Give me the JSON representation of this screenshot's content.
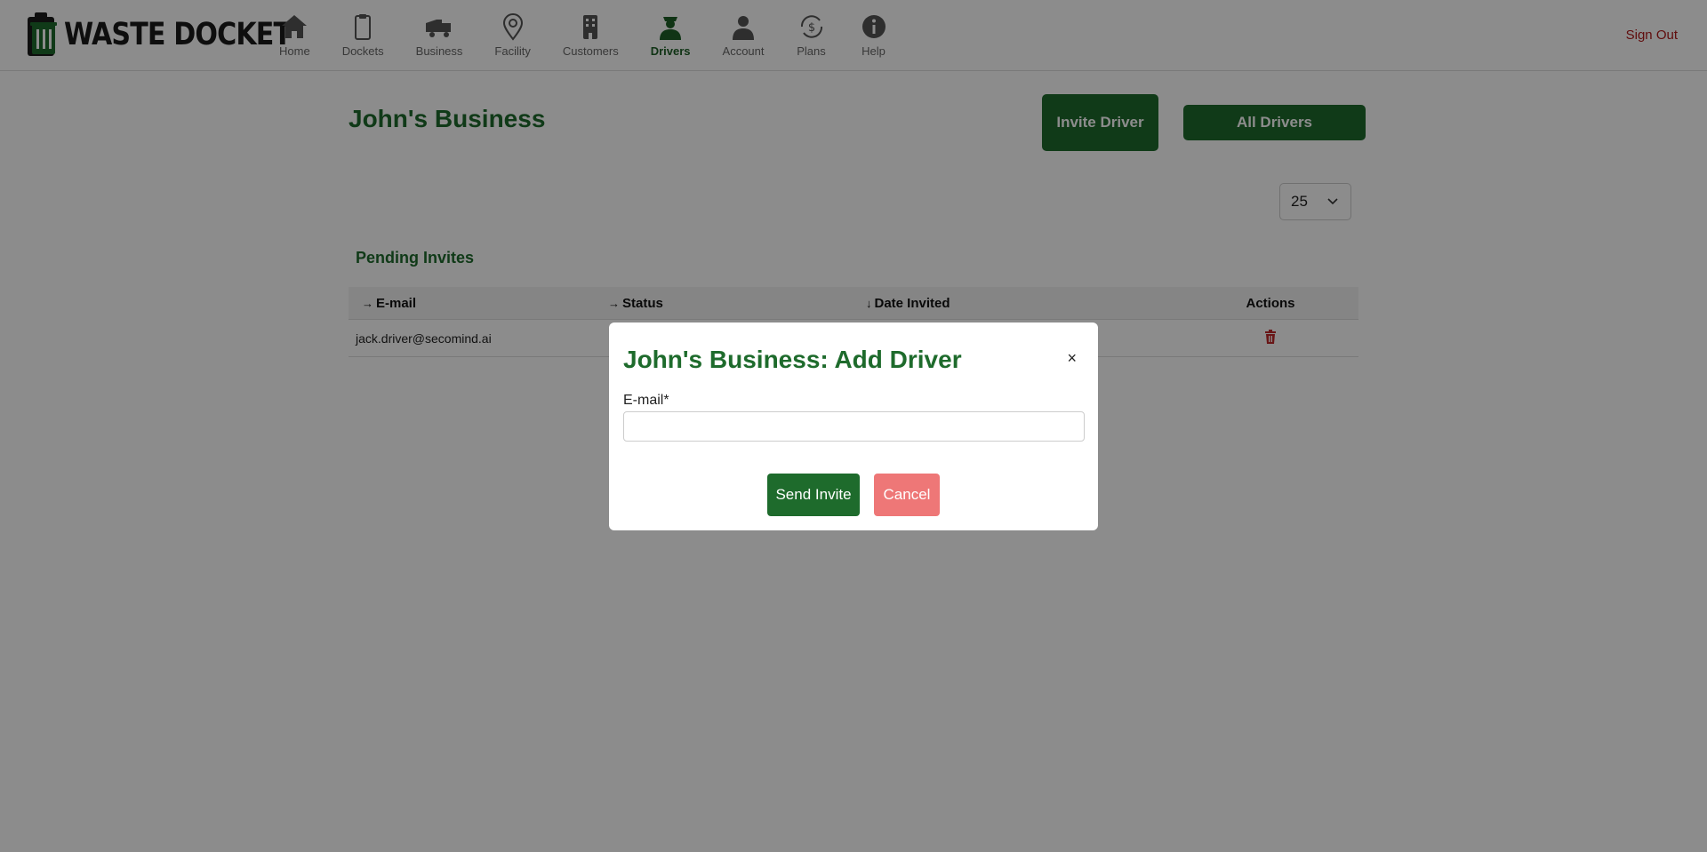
{
  "app": {
    "logo_text": "WASTE DOCKET",
    "sign_out": "Sign Out"
  },
  "nav": [
    {
      "label": "Home",
      "icon": "home-icon"
    },
    {
      "label": "Dockets",
      "icon": "clipboard-icon"
    },
    {
      "label": "Business",
      "icon": "truck-icon"
    },
    {
      "label": "Facility",
      "icon": "location-pin-icon"
    },
    {
      "label": "Customers",
      "icon": "building-icon"
    },
    {
      "label": "Drivers",
      "icon": "driver-icon",
      "active": true
    },
    {
      "label": "Account",
      "icon": "user-icon"
    },
    {
      "label": "Plans",
      "icon": "dollar-cycle-icon"
    },
    {
      "label": "Help",
      "icon": "info-icon"
    }
  ],
  "main": {
    "title": "John's Business",
    "invite_driver": "Invite Driver",
    "all_drivers": "All Drivers",
    "page_size": "25",
    "section_title": "Pending Invites",
    "columns": {
      "email": "E-mail",
      "status": "Status",
      "date": "Date Invited",
      "actions": "Actions"
    },
    "rows": [
      {
        "email": "jack.driver@secomind.ai"
      }
    ]
  },
  "modal": {
    "title": "John's Business: Add Driver",
    "close": "×",
    "email_label": "E-mail*",
    "email_value": "",
    "send": "Send Invite",
    "cancel": "Cancel"
  },
  "colors": {
    "brand": "#1e6b2c",
    "danger": "#c0282a",
    "cancel": "#ee7777"
  }
}
